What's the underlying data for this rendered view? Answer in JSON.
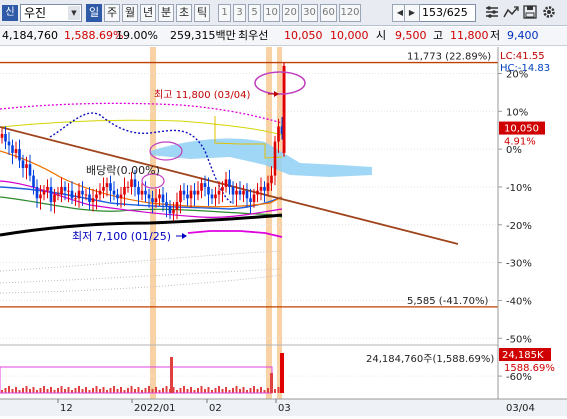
{
  "toolbar": {
    "code_badge": "신",
    "stock_name": "우진",
    "period_buttons": [
      "일",
      "주",
      "월",
      "년",
      "분",
      "초",
      "틱"
    ],
    "interval_buttons": [
      "1",
      "3",
      "5",
      "10",
      "20",
      "30",
      "60",
      "120"
    ],
    "count_display": "153/625",
    "active_period": "일"
  },
  "infobar": {
    "volume": "4,184,760",
    "volume_change": "1,588.69%",
    "turnover": "19.00%",
    "trade_value": "259,315백만",
    "preferred_label": "최우선",
    "preferred_price": "10,050",
    "preferred_price2": "10,000",
    "open_label": "시",
    "open_value": "9,500",
    "high_label": "고",
    "high_value": "11,800",
    "low_label": "저",
    "low_value": "9,400"
  },
  "legend": {
    "lc": "LC:41.55",
    "hc": "HC:-14.83"
  },
  "chart_data": {
    "type": "candlestick",
    "y_axis_unit": "% from reference",
    "ylim": [
      -65,
      27
    ],
    "y_ticks": [
      "20%",
      "10%",
      "0%",
      "-10%",
      "-20%",
      "-30%",
      "-40%",
      "-50%",
      "-60%"
    ],
    "x_ticks": [
      "12",
      "2022/01",
      "02",
      "03"
    ],
    "x_ticks_right": "03/04",
    "current_price": "10,050",
    "current_change": "4.91%",
    "current_change_pct": 4.91,
    "reference_lines": [
      {
        "label": "11,773 (22.89%)",
        "pct": 22.89,
        "color": "#c04000"
      },
      {
        "label": "5,585 (-41.70%)",
        "pct": -41.7,
        "color": "#c04000"
      }
    ],
    "annotations": {
      "high": "최고 11,800 (03/04)",
      "low": "최저 7,100 (01/25)",
      "dividend": "배당락(0.00%)"
    },
    "volume_label": "24,184,760주(1,588.69%)",
    "volume_badge": "24,185K",
    "volume_badge_pct": "1588.69%",
    "candles_pct": [
      4,
      2,
      1,
      -1,
      0,
      -3,
      -5,
      -4,
      -7,
      -10,
      -13,
      -12,
      -11,
      -10,
      -14,
      -12,
      -12,
      -10,
      -11,
      -11,
      -13,
      -13,
      -11,
      -12,
      -12,
      -14,
      -13,
      -12,
      -11,
      -10,
      -9,
      -11,
      -12,
      -13,
      -12,
      -10,
      -10,
      -8,
      -10,
      -12,
      -11,
      -12,
      -13,
      -14,
      -13,
      -12,
      -14,
      -15,
      -17,
      -16,
      -14,
      -11,
      -12,
      -13,
      -11,
      -12,
      -11,
      -9,
      -10,
      -12,
      -13,
      -12,
      -11,
      -10,
      -8,
      -10,
      -12,
      -11,
      -12,
      -11,
      -13,
      -14,
      -12,
      -11,
      -10,
      -11,
      -9,
      -7,
      2,
      6,
      4
    ]
  }
}
